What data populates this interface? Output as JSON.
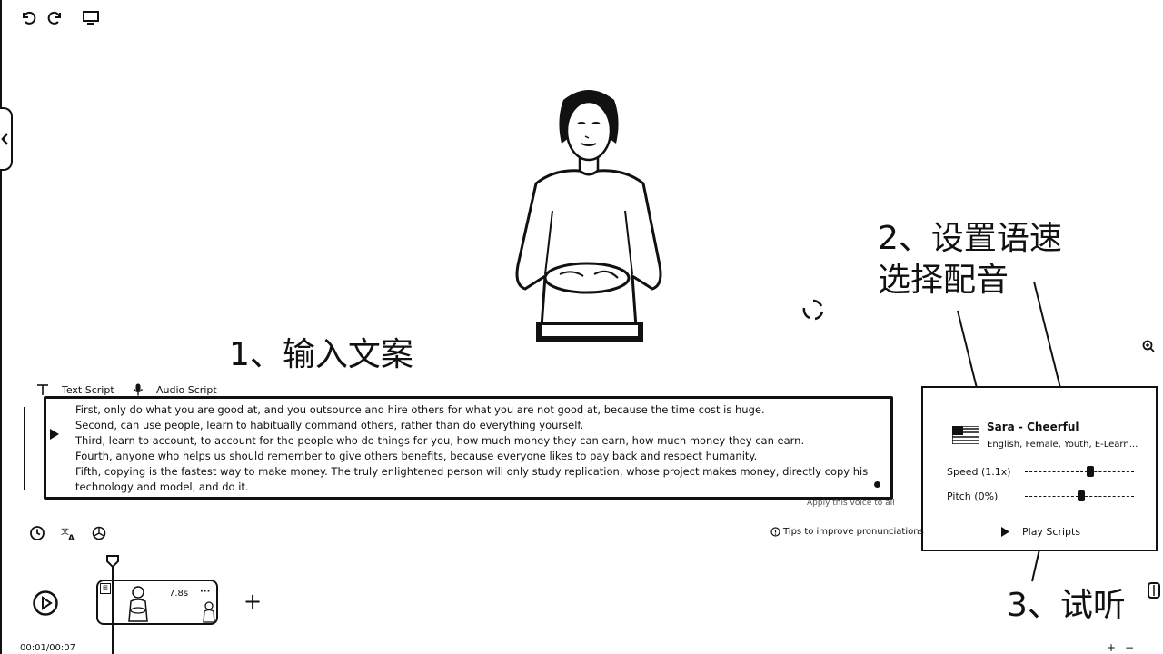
{
  "toolbar": {
    "undo_icon": "undo-icon",
    "redo_icon": "redo-icon",
    "preview_icon": "monitor-icon"
  },
  "annotations": {
    "step1": "1、输入文案",
    "step2_line1": "2、设置语速",
    "step2_line2": "选择配音",
    "step3": "3、试听"
  },
  "tabs": [
    {
      "label": "Text Script",
      "icon": "text-icon"
    },
    {
      "label": "Audio Script",
      "icon": "microphone-icon"
    }
  ],
  "script": {
    "lines": [
      "First, only do what you are good at, and you outsource and hire others for what you are not good at, because the time cost is huge.",
      "Second, can use people, learn to habitually command others, rather than do everything yourself.",
      "Third, learn to account, to account for the people who do things for you, how much money they can earn, how much money they can earn.",
      "Fourth, anyone who helps us should remember to give others benefits, because everyone likes to pay back and respect humanity.",
      "Fifth, copying is the fastest way to make money. The truly enlightened person will only study replication, whose project makes money, directly copy his technology and model, and do it."
    ]
  },
  "apply_voice_text": "Apply this voice to all",
  "tips_text": "Tips to improve pronunciations",
  "voice": {
    "name": "Sara - Cheerful",
    "description": "English, Female, Youth, E-Learn...",
    "speed_label": "Speed (1.1x)",
    "speed_value": 1.1,
    "pitch_label": "Pitch (0%)",
    "pitch_value": 0,
    "play_label": "Play Scripts"
  },
  "timeline": {
    "clip_duration": "7.8s",
    "clip_more": "···",
    "add_label": "+",
    "time": "00:01/00:07"
  },
  "bottom_right": {
    "zoom_in": "+",
    "zoom_out": "−"
  }
}
